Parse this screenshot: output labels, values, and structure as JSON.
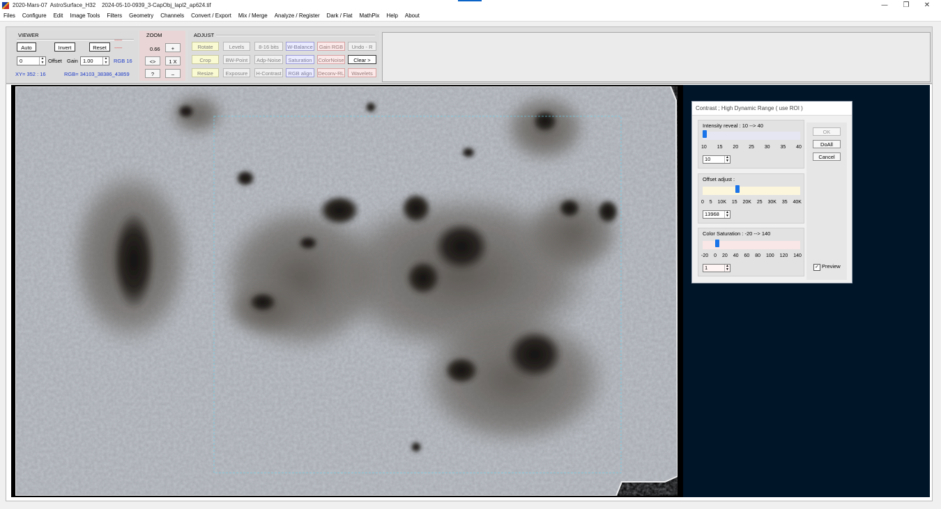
{
  "window": {
    "title": "2020-Mars-07  AstroSurface_H32    2024-05-10-0939_3-CapObj_lapl2_ap624.tif",
    "minimize": "—",
    "restore": "❐",
    "close": "✕"
  },
  "menu": [
    "Files",
    "Configure",
    "Edit",
    "Image Tools",
    "Filters",
    "Geometry",
    "Channels",
    "Convert / Export",
    "Mix / Merge",
    "Analyze / Register",
    "Dark / Flat",
    "MathPix",
    "Help",
    "About"
  ],
  "viewer": {
    "title": "VIEWER",
    "auto": "Auto",
    "invert": "Invert",
    "reset": "Reset",
    "offset_value": "0",
    "offset_label": "Offset",
    "gain_label": "Gain",
    "gain_value": "1.00",
    "rgb_mode": "RGB 16",
    "xy_readout": "XY=  352 : 16",
    "rgb_readout": "RGB=  34103_38386_43859",
    "dash1": "------",
    "dash2": "------"
  },
  "zoom": {
    "title": "ZOOM",
    "level": "0.66",
    "plus": "+",
    "fit": "<>",
    "one_x": "1 X",
    "help": "?",
    "minus": "–"
  },
  "adjust": {
    "title": "ADJUST",
    "row1": [
      "Rotate",
      "Levels",
      "8-16 bits",
      "W-Balance",
      "Gain RGB",
      "Undo - R"
    ],
    "row2": [
      "Crop",
      "BW-Point",
      "Adp-Noise",
      "Saturation",
      "ColorNoise",
      "Clear >"
    ],
    "row3": [
      "Resize",
      "Exposure",
      "H-Contrast",
      "RGB align",
      "Deconv-RL",
      "Wavelets"
    ]
  },
  "dialog": {
    "title": "Contrast ; High Dynamic Range  ( use ROI )",
    "intensity": {
      "label": "Intensity reveal :  10  --> 40",
      "ticks": [
        "10",
        "15",
        "20",
        "25",
        "30",
        "35",
        "40"
      ],
      "value": "10",
      "min": 10,
      "max": 40,
      "current": 10
    },
    "offset": {
      "label": "Offset adjust :",
      "ticks": [
        "0",
        "5",
        "10K",
        "15",
        "20K",
        "25",
        "30K",
        "35",
        "40K"
      ],
      "value": "13968",
      "min": 0,
      "max": 40000,
      "current": 13968
    },
    "saturation": {
      "label": "Color Saturation :  -20  --> 140",
      "ticks": [
        "-20",
        "0",
        "20",
        "40",
        "60",
        "80",
        "100",
        "120",
        "140"
      ],
      "value": "1",
      "min": -20,
      "max": 140,
      "current": 1
    },
    "ok": "OK",
    "doall": "DoAll",
    "cancel": "Cancel",
    "preview": "Preview",
    "preview_checked": true
  }
}
